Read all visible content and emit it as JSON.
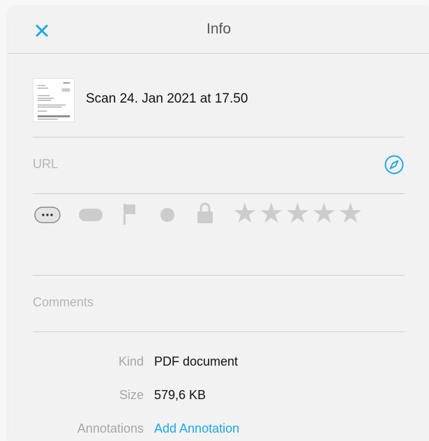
{
  "header": {
    "title": "Info"
  },
  "document": {
    "name": "Scan 24. Jan 2021 at 17.50"
  },
  "url": {
    "placeholder": "URL",
    "value": ""
  },
  "comments": {
    "placeholder": "Comments",
    "value": ""
  },
  "rating": {
    "stars": [
      "★",
      "★",
      "★",
      "★",
      "★"
    ],
    "value": 0
  },
  "meta": {
    "kind_label": "Kind",
    "kind_value": "PDF document",
    "size_label": "Size",
    "size_value": "579,6 KB",
    "annotations_label": "Annotations",
    "annotations_value": "Add Annotation"
  },
  "colors": {
    "accent": "#1ea7e4",
    "icon_gray": "#cccccc",
    "label_gray": "#a6a6a6"
  }
}
